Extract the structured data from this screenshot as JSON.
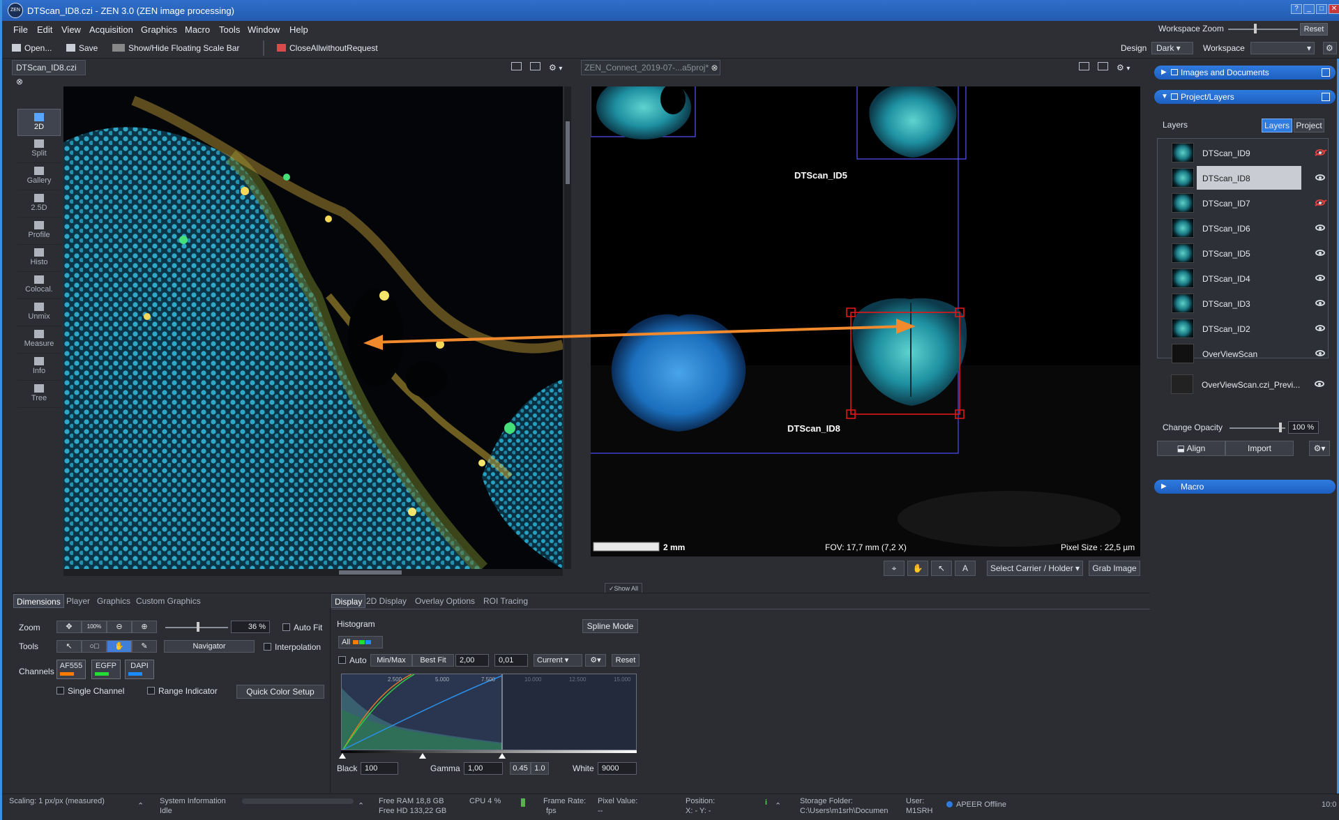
{
  "title_bar": {
    "title": "DTScan_ID8.czi - ZEN 3.0 (ZEN image processing)",
    "logo": "ZEN",
    "buttons": [
      "?",
      "_",
      "□",
      "✕"
    ]
  },
  "menu": [
    "File",
    "Edit",
    "View",
    "Acquisition",
    "Graphics",
    "Macro",
    "Tools",
    "Window",
    "Help"
  ],
  "workspace_zoom": {
    "label": "Workspace Zoom",
    "reset": "Reset"
  },
  "toolbar": {
    "open": "Open...",
    "save": "Save",
    "scalebar": "Show/Hide Floating Scale Bar",
    "close": "CloseAllwithoutRequest",
    "design_label": "Design",
    "design_value": "Dark",
    "workspace_label": "Workspace",
    "workspace_value": ""
  },
  "left_doc": {
    "tab": "DTScan_ID8.czi"
  },
  "view_tools": [
    "2D",
    "Split",
    "Gallery",
    "2.5D",
    "Profile",
    "Histo",
    "Colocal.",
    "Unmix",
    "Measure",
    "Info",
    "Tree"
  ],
  "right_doc": {
    "tab": "ZEN_Connect_2019-07-...a5proj*",
    "label_id5": "DTScan_ID5",
    "label_id8": "DTScan_ID8",
    "scale_bar": "2 mm",
    "fov": "FOV: 17,7 mm (7,2 X)",
    "pixel_size": "Pixel Size : 22,5 µm"
  },
  "view_bar": {
    "carrier": "Select Carrier / Holder",
    "grab": "Grab Image",
    "show_all": "Show All",
    "text_tool": "A"
  },
  "right_panel": {
    "images_docs": "Images and Documents",
    "project_layers": "Project/Layers",
    "layers_label": "Layers",
    "tab_layers": "Layers",
    "tab_project": "Project",
    "layers": [
      {
        "name": "DTScan_ID9",
        "visible": false
      },
      {
        "name": "DTScan_ID8",
        "visible": true,
        "selected": true
      },
      {
        "name": "DTScan_ID7",
        "visible": false
      },
      {
        "name": "DTScan_ID6",
        "visible": true
      },
      {
        "name": "DTScan_ID5",
        "visible": true
      },
      {
        "name": "DTScan_ID4",
        "visible": true
      },
      {
        "name": "DTScan_ID3",
        "visible": true
      },
      {
        "name": "DTScan_ID2",
        "visible": true
      },
      {
        "name": "OverViewScan",
        "visible": true
      },
      {
        "name": "OverViewScan.czi_Previ...",
        "visible": true
      }
    ],
    "opacity_label": "Change Opacity",
    "opacity_value": "100 %",
    "align": "Align",
    "import": "Import",
    "macro": "Macro"
  },
  "bottom_left": {
    "tabs": [
      "Dimensions",
      "Player",
      "Graphics",
      "Custom Graphics"
    ],
    "zoom_label": "Zoom",
    "zoom_100": "100%",
    "zoom_value": "36 %",
    "auto_fit": "Auto Fit",
    "tools_label": "Tools",
    "navigator": "Navigator",
    "interpolation": "Interpolation",
    "channels_label": "Channels",
    "channels": [
      {
        "name": "AF555",
        "color": "#ff7a00"
      },
      {
        "name": "EGFP",
        "color": "#22dd33"
      },
      {
        "name": "DAPI",
        "color": "#1a8cff"
      }
    ],
    "single_channel": "Single Channel",
    "range_indicator": "Range Indicator",
    "quick_color": "Quick Color Setup"
  },
  "bottom_right": {
    "tabs": [
      "Display",
      "2D Display",
      "Overlay Options",
      "ROI Tracing"
    ],
    "histogram_label": "Histogram",
    "spline": "Spline Mode",
    "all": "All",
    "auto": "Auto",
    "minmax": "Min/Max",
    "bestfit": "Best Fit",
    "val1": "2,00",
    "val2": "0,01",
    "current": "Current",
    "reset": "Reset",
    "axis_ticks": [
      "2.500",
      "5.000",
      "7.500",
      "10.000",
      "12.500",
      "15.000"
    ],
    "black_label": "Black",
    "black_value": "100",
    "gamma_label": "Gamma",
    "gamma_value": "1,00",
    "gamma_045": "0.45",
    "gamma_10": "1.0",
    "white_label": "White",
    "white_value": "9000"
  },
  "status": {
    "scaling": "Scaling:   1 px/px (measured)",
    "sysinfo": "System Information",
    "idle": "Idle",
    "ram": "Free RAM  18,8 GB",
    "hd": "Free HD    133,22 GB",
    "cpu": "CPU 4 %",
    "frame": "Frame Rate:",
    "fps": "fps",
    "pixel": "Pixel Value:",
    "pixel_val": "--",
    "position": "Position:",
    "pos_xy": "X: -        Y: -",
    "storage": "Storage Folder:",
    "storage_path": "C:\\Users\\m1srh\\Documen",
    "user": "User:",
    "user_val": "M1SRH",
    "apeer": "APEER Offline",
    "time": "10:0"
  }
}
